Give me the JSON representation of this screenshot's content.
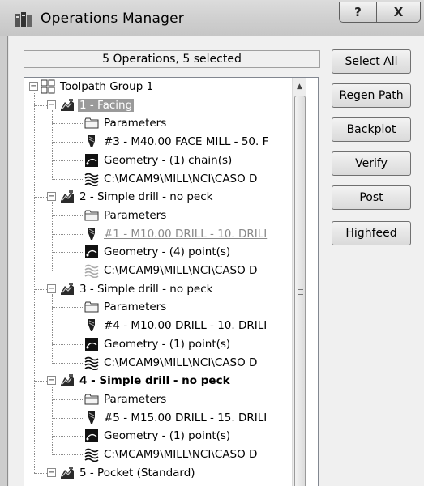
{
  "window": {
    "title": "Operations Manager",
    "help_glyph": "?",
    "close_glyph": "X"
  },
  "status": "5 Operations, 5 selected",
  "buttons": [
    {
      "label": "Select All"
    },
    {
      "label": "Regen Path"
    },
    {
      "label": "Backplot"
    },
    {
      "label": "Verify"
    },
    {
      "label": "Post"
    },
    {
      "label": "Highfeed"
    }
  ],
  "tree": {
    "root_label": "Toolpath Group 1",
    "operations": [
      {
        "label": "1 - Facing",
        "selected": true,
        "bold": false,
        "children": [
          {
            "icon": "folder-icon",
            "label": "Parameters"
          },
          {
            "icon": "tool-icon",
            "label": "#3 - M40.00 FACE MILL - 50. F"
          },
          {
            "icon": "geometry-icon",
            "label": "Geometry - (1) chain(s)"
          },
          {
            "icon": "nci-file-icon",
            "label": "C:\\MCAM9\\MILL\\NCI\\CASO D"
          }
        ]
      },
      {
        "label": "2 - Simple drill - no peck",
        "selected": false,
        "bold": false,
        "children": [
          {
            "icon": "folder-icon",
            "label": "Parameters"
          },
          {
            "icon": "tool-icon",
            "label": "#1 - M10.00 DRILL - 10. DRILI",
            "grey": true
          },
          {
            "icon": "geometry-icon",
            "label": "Geometry - (4) point(s)"
          },
          {
            "icon": "nci-file-icon",
            "label": "C:\\MCAM9\\MILL\\NCI\\CASO D",
            "faded": true
          }
        ]
      },
      {
        "label": "3 - Simple drill - no peck",
        "selected": false,
        "bold": false,
        "children": [
          {
            "icon": "folder-icon",
            "label": "Parameters"
          },
          {
            "icon": "tool-icon",
            "label": "#4 - M10.00 DRILL - 10. DRILI"
          },
          {
            "icon": "geometry-icon",
            "label": "Geometry - (1) point(s)"
          },
          {
            "icon": "nci-file-icon",
            "label": "C:\\MCAM9\\MILL\\NCI\\CASO D"
          }
        ]
      },
      {
        "label": "4 - Simple drill - no peck",
        "selected": false,
        "bold": true,
        "children": [
          {
            "icon": "folder-icon",
            "label": "Parameters"
          },
          {
            "icon": "tool-icon",
            "label": "#5 - M15.00 DRILL - 15. DRILI"
          },
          {
            "icon": "geometry-icon",
            "label": "Geometry - (1) point(s)"
          },
          {
            "icon": "nci-file-icon",
            "label": "C:\\MCAM9\\MILL\\NCI\\CASO D"
          }
        ]
      },
      {
        "label": "5 - Pocket (Standard)",
        "selected": false,
        "bold": false,
        "children": []
      }
    ]
  },
  "icons": {
    "title": "operations-manager-icon",
    "expand_minus": "−",
    "scroll_up": "▲"
  }
}
